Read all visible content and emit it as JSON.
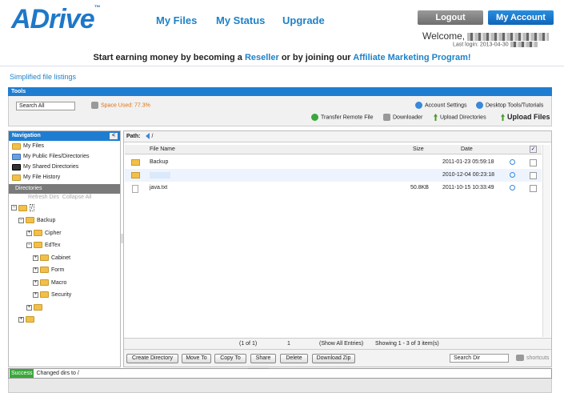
{
  "header": {
    "logo": "ADrive",
    "logo_mark": "™",
    "nav": [
      "My Files",
      "My Status",
      "Upgrade"
    ],
    "logout": "Logout",
    "my_account": "My Account",
    "welcome": "Welcome,",
    "last_login": "Last login: 2013-04-30"
  },
  "promo": {
    "prefix": "Start earning money by becoming a",
    "reseller": "Reseller",
    "middle": "or by joining our",
    "affiliate": "Affiliate Marketing Program!"
  },
  "simplified_link": "Simplified file listings",
  "tools": {
    "title": "Tools",
    "search_value": "Search All",
    "space_used": "Space Used: 77.3%",
    "account_settings": "Account Settings",
    "desktop_tools": "Desktop Tools/Tutorials",
    "transfer_remote": "Transfer Remote File",
    "downloader": "Downloader",
    "upload_directories": "Upload Directories",
    "upload_files": "Upload Files"
  },
  "navigation": {
    "title": "Navigation",
    "close": "<",
    "items": [
      "My Files",
      "My Public Files/Directories",
      "My Shared Directories",
      "My File History"
    ],
    "directories": "Directories",
    "refresh": "Refresh Dirs",
    "collapse": "Collapse All",
    "tree": [
      {
        "label": "/",
        "level": 0
      },
      {
        "label": "Backup",
        "level": 1
      },
      {
        "label": "Cipher",
        "level": 2
      },
      {
        "label": "EdTex",
        "level": 2
      },
      {
        "label": "Cabinet",
        "level": 3
      },
      {
        "label": "Form",
        "level": 3
      },
      {
        "label": "Macro",
        "level": 3
      },
      {
        "label": "Security",
        "level": 3
      },
      {
        "label": "",
        "level": 2
      },
      {
        "label": "",
        "level": 1
      }
    ]
  },
  "main": {
    "path_label": "Path:",
    "path_value": "/",
    "columns": [
      "File Name",
      "Size",
      "Date"
    ],
    "rows": [
      {
        "type": "folder",
        "name": "Backup",
        "size": "",
        "date": "2011-01-23 05:59:18"
      },
      {
        "type": "folder",
        "name": "",
        "size": "",
        "date": "2010-12-04 00:23:18"
      },
      {
        "type": "file",
        "name": "java.txt",
        "size": "50.8KB",
        "date": "2011-10-15 10:33:49"
      }
    ],
    "pager": {
      "pages": "(1 of 1)",
      "page": "1",
      "show_all": "(Show All Entries)",
      "showing": "Showing 1 - 3 of 3 item(s)"
    },
    "actions": [
      "Create Directory",
      "Move To",
      "Copy To",
      "Share",
      "Delete",
      "Download Zip"
    ],
    "search_dir": "Search Dir",
    "shortcuts": "shortcuts"
  },
  "status": {
    "badge": "Success",
    "message": "Changed dirs to /"
  }
}
